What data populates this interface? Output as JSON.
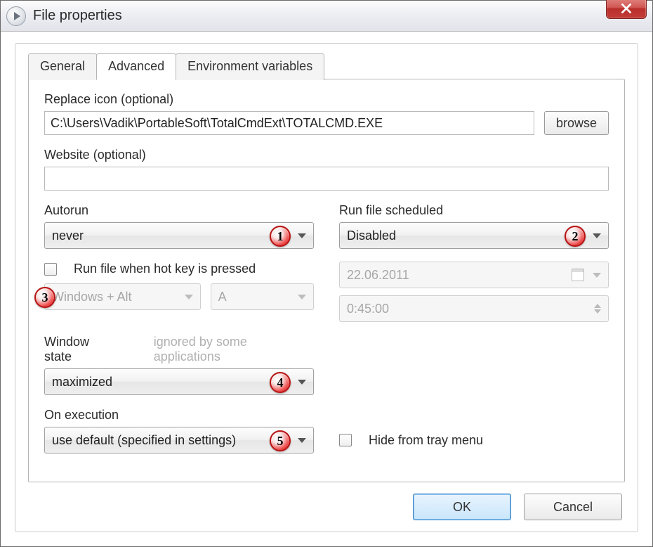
{
  "window": {
    "title": "File properties"
  },
  "tabs": {
    "general": "General",
    "advanced": "Advanced",
    "env": "Environment variables",
    "active": "advanced"
  },
  "replaceIcon": {
    "label": "Replace icon (optional)",
    "value": "C:\\Users\\Vadik\\PortableSoft\\TotalCmdExt\\TOTALCMD.EXE",
    "browse": "browse"
  },
  "website": {
    "label": "Website (optional)",
    "value": ""
  },
  "autorun": {
    "label": "Autorun",
    "value": "never"
  },
  "scheduled": {
    "label": "Run file scheduled",
    "value": "Disabled",
    "date": "22.06.2011",
    "time": "0:45:00"
  },
  "hotkey": {
    "label": "Run file when hot key is pressed",
    "checked": false,
    "modifier": "Windows + Alt",
    "key": "A"
  },
  "windowState": {
    "label": "Window state",
    "hint": "ignored by some applications",
    "value": "maximized"
  },
  "onExecution": {
    "label": "On execution",
    "value": "use default (specified in settings)"
  },
  "hideTray": {
    "label": "Hide from tray menu",
    "checked": false
  },
  "badges": {
    "b1": "1",
    "b2": "2",
    "b3": "3",
    "b4": "4",
    "b5": "5"
  },
  "buttons": {
    "ok": "OK",
    "cancel": "Cancel"
  }
}
